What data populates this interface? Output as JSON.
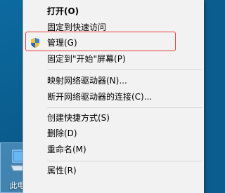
{
  "desktop": {
    "icon_label": "此电脑"
  },
  "context_menu": {
    "items": [
      {
        "label": "打开(O)"
      },
      {
        "label": "固定到快速访问"
      },
      {
        "label": "管理(G)"
      },
      {
        "label": "固定到\"开始\"屏幕(P)"
      },
      {
        "label": "映射网络驱动器(N)..."
      },
      {
        "label": "断开网络驱动器的连接(C)..."
      },
      {
        "label": "创建快捷方式(S)"
      },
      {
        "label": "删除(D)"
      },
      {
        "label": "重命名(M)"
      },
      {
        "label": "属性(R)"
      }
    ]
  },
  "colors": {
    "highlight_border": "#e8413b",
    "menu_background": "#f2f2f2",
    "desktop_background": "#0a5d8e"
  },
  "icons": {
    "manage": "uac-shield-icon",
    "desktop": "this-pc-icon"
  }
}
